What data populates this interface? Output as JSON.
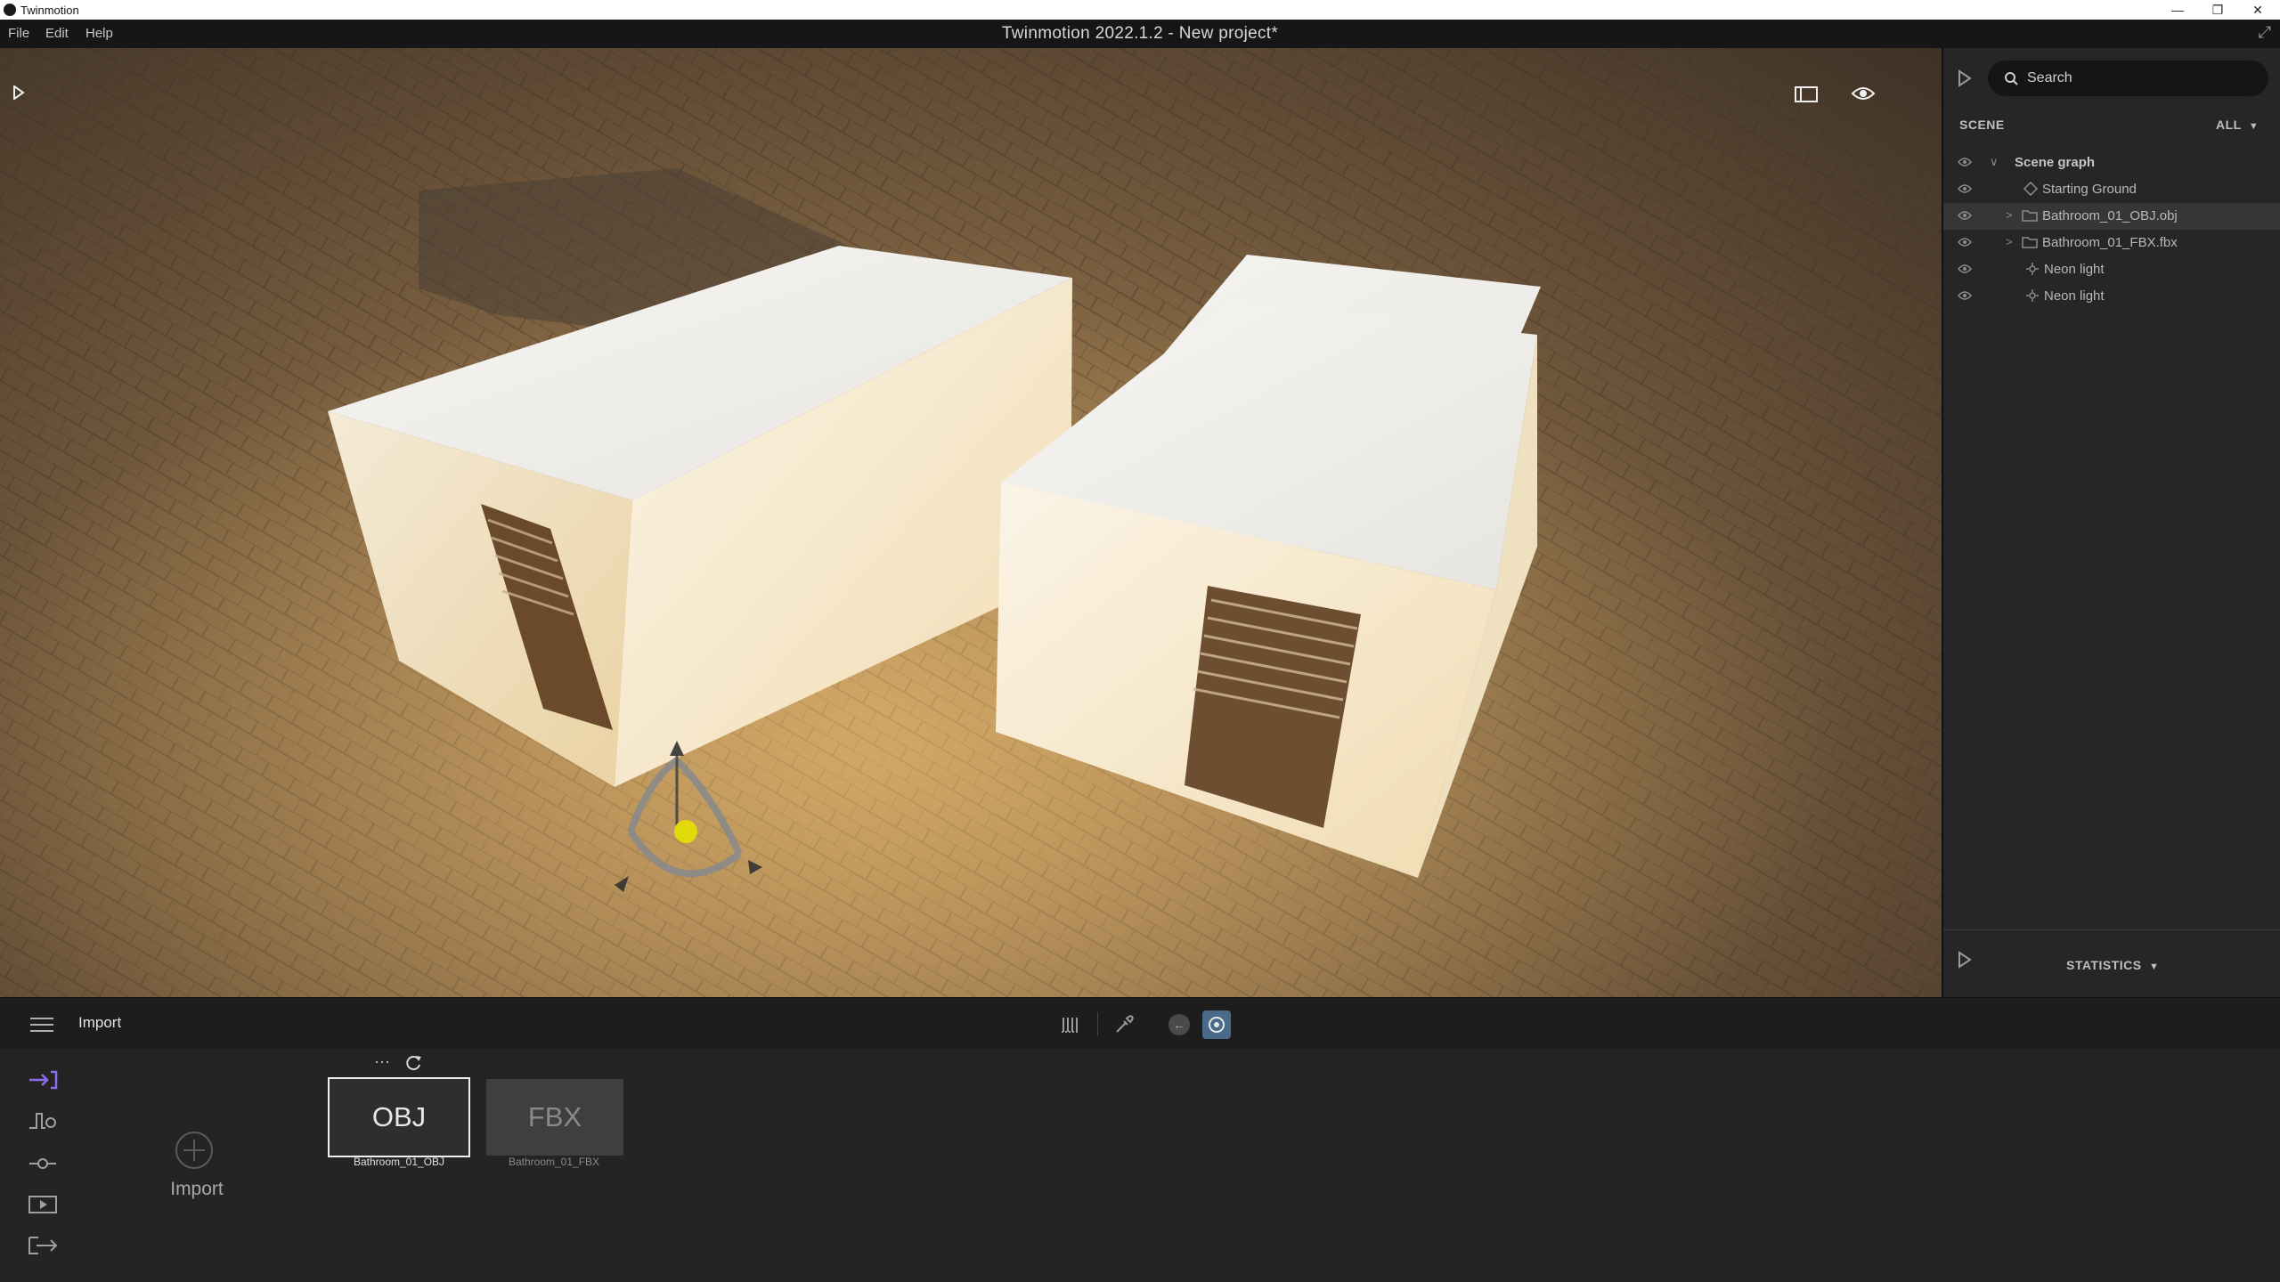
{
  "os_titlebar": {
    "app_name": "Twinmotion",
    "buttons": [
      "—",
      "❐",
      "✕"
    ]
  },
  "menubar": {
    "menus": [
      "File",
      "Edit",
      "Help"
    ],
    "title": "Twinmotion 2022.1.2 - New project*"
  },
  "viewport": {
    "icons": [
      "play-icon",
      "frame-icon",
      "eye-icon"
    ]
  },
  "right_panel": {
    "search_placeholder": "Search",
    "scene_label": "SCENE",
    "filter_label": "ALL",
    "tree": [
      {
        "label": "Scene graph",
        "type": "root"
      },
      {
        "label": "Starting Ground",
        "type": "ground"
      },
      {
        "label": "Bathroom_01_OBJ.obj",
        "type": "folder",
        "selected": true
      },
      {
        "label": "Bathroom_01_FBX.fbx",
        "type": "folder"
      },
      {
        "label": "Neon light",
        "type": "light"
      },
      {
        "label": "Neon light",
        "type": "light"
      }
    ],
    "statistics_label": "STATISTICS"
  },
  "dock": {
    "section_title": "Import",
    "import_button_label": "Import",
    "assets": [
      {
        "thumb": "OBJ",
        "name": "Bathroom_01_OBJ",
        "selected": true
      },
      {
        "thumb": "FBX",
        "name": "Bathroom_01_FBX",
        "selected": false
      }
    ],
    "toolbar_more": "···"
  },
  "colors": {
    "accent_purple": "#8e6cf0",
    "toolbar_active": "#4a6a8a",
    "viewport_ground": "#8a6c47"
  }
}
